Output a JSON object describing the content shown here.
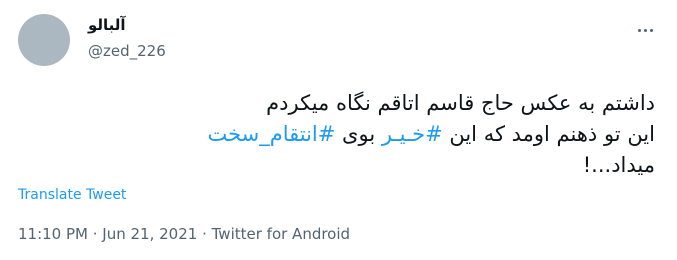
{
  "author": {
    "display_name": "آلبالو",
    "handle": "@zed_226"
  },
  "menu": {
    "icon": "more-horizontal-icon"
  },
  "tweet": {
    "line1": "داشتم به عکس حاج قاسم اتاقم نگاه میکردم",
    "line2_before": "این تو ذهنم اومد که این ",
    "hashtag1": "#خـیـر",
    "line2_middle": " بوی ",
    "hashtag2": "#انتقام_سخت",
    "line3": "میداد...!"
  },
  "translate_label": "Translate Tweet",
  "meta": {
    "time": "11:10 PM",
    "separator": " · ",
    "date": "Jun 21, 2021",
    "source": "Twitter for Android"
  },
  "colors": {
    "link": "#1d9bf0",
    "text": "#0f1419",
    "secondary": "#536471",
    "avatar": "#acb8c1"
  }
}
